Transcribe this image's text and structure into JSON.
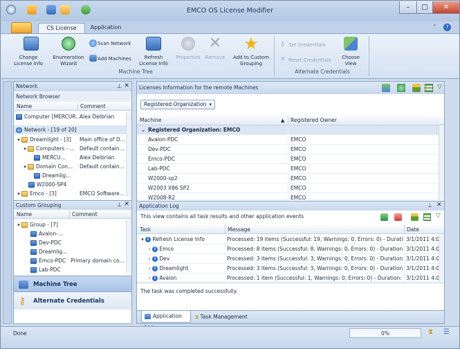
{
  "window": {
    "title": "EMCO OS License Modifier",
    "minimize": "–",
    "maximize": "□",
    "close": "✕"
  },
  "ribbon_tabs": [
    "CS License",
    "Application"
  ],
  "ribbon": {
    "buttons": [
      {
        "label": "Change\nLicense Info",
        "icon": "license-edit-icon"
      },
      {
        "label": "Enumeration\nWizard",
        "icon": "wizard-icon"
      },
      {
        "label": "Scan Network",
        "icon": "scan-network-icon"
      },
      {
        "label": "Add Machines",
        "icon": "add-machines-icon"
      },
      {
        "label": "Refresh\nLicense Info",
        "icon": "refresh-icon"
      },
      {
        "label": "Properties",
        "icon": "properties-icon"
      },
      {
        "label": "Remove",
        "icon": "remove-icon"
      },
      {
        "label": "Add to Custom\nGrouping",
        "icon": "star-icon"
      },
      {
        "label": "Set Credentials",
        "icon": "key-icon"
      },
      {
        "label": "Reset Credentials",
        "icon": "reset-key-icon"
      },
      {
        "label": "Choose\nView",
        "icon": "choose-view-icon"
      }
    ],
    "groups": [
      "Machine Tree",
      "Alternate Credentials"
    ]
  },
  "left": {
    "network_title": "Network",
    "browser_title": "Network Browser",
    "browser_cols": [
      "Name",
      "Comment"
    ],
    "computer_row": {
      "name": "Computer [MERCUR...",
      "comment": "Alex Delbrian"
    },
    "network_node": "Network - [19 of 20]",
    "tree": [
      {
        "name": "Dreamlight - [3]",
        "comment": "Main office of D..."
      },
      {
        "name": "Computers - ...",
        "comment": "Default contain..."
      },
      {
        "name": "MERCU...",
        "comment": "Alex Delbrian"
      },
      {
        "name": "Domain Con...",
        "comment": "Default contain..."
      },
      {
        "name": "Dreamlig...",
        "comment": ""
      },
      {
        "name": "W2000-SP4",
        "comment": ""
      },
      {
        "name": "Emco - [3]",
        "comment": "EMCO Software..."
      }
    ],
    "custom_title": "Custom Grouping",
    "custom_cols": [
      "Name",
      "Comment"
    ],
    "custom_tree": [
      {
        "name": "Group - [7]",
        "comment": ""
      },
      {
        "name": "Avalon-...",
        "comment": ""
      },
      {
        "name": "Dev-PDC",
        "comment": ""
      },
      {
        "name": "Dreamlig...",
        "comment": ""
      },
      {
        "name": "Emco-PDC",
        "comment": "Primary domain co..."
      },
      {
        "name": "Lab-PDC",
        "comment": ""
      }
    ],
    "nav": [
      "Machine Tree",
      "Alternate Credentials"
    ]
  },
  "main": {
    "title": "Licenses Information for the remote Machines",
    "groupby": "Registered Organization",
    "cols": [
      "Machine",
      "Registered Owner"
    ],
    "group_row": "Registered Organization: EMCO",
    "rows": [
      {
        "machine": "Avalon-PDC",
        "owner": "EMCO"
      },
      {
        "machine": "Dev-PDC",
        "owner": "EMCO"
      },
      {
        "machine": "Emco-PDC",
        "owner": "EMCO"
      },
      {
        "machine": "Lab-PDC",
        "owner": "EMCO"
      },
      {
        "machine": "W2000-sp2",
        "owner": "EMCO"
      },
      {
        "machine": "W2003 X86 SP2",
        "owner": "EMCO"
      },
      {
        "machine": "W2008-R2",
        "owner": "EMCO"
      }
    ]
  },
  "log": {
    "title": "Application Log",
    "desc": "This view contains all task results and other application events",
    "cols": [
      "Task",
      "Message",
      "Date"
    ],
    "rows": [
      {
        "task": "Refresh License Info",
        "message": "Processed: 19 items (Successful: 19, Warnings: 0, Errors: 0) - Duration...",
        "date": "3/1/2011 4:0"
      },
      {
        "task": "Emco",
        "message": "Processed: 8 items (Successful: 8, Warnings: 0, Errors: 0) - Duration: 2...",
        "date": "3/1/2011 4:0"
      },
      {
        "task": "Dev",
        "message": "Processed: 3 items (Successful: 3, Warnings: 0, Errors: 0) - Duration: 2...",
        "date": "3/1/2011 4:0"
      },
      {
        "task": "Dreamlight",
        "message": "Processed: 3 items (Successful: 3, Warnings: 0, Errors: 0) - Duration: 2...",
        "date": "3/1/2011 4:0"
      },
      {
        "task": "Avalon",
        "message": "Processed: 1 item (Successful: 1, Warnings: 0, Errors: 0) - Duration: les...",
        "date": "3/1/2011 4:0"
      }
    ],
    "detail": "The task was completed successfully.",
    "tabs": [
      "Application Log",
      "Task Management"
    ]
  },
  "status": {
    "text": "Done",
    "progress": "0%"
  }
}
